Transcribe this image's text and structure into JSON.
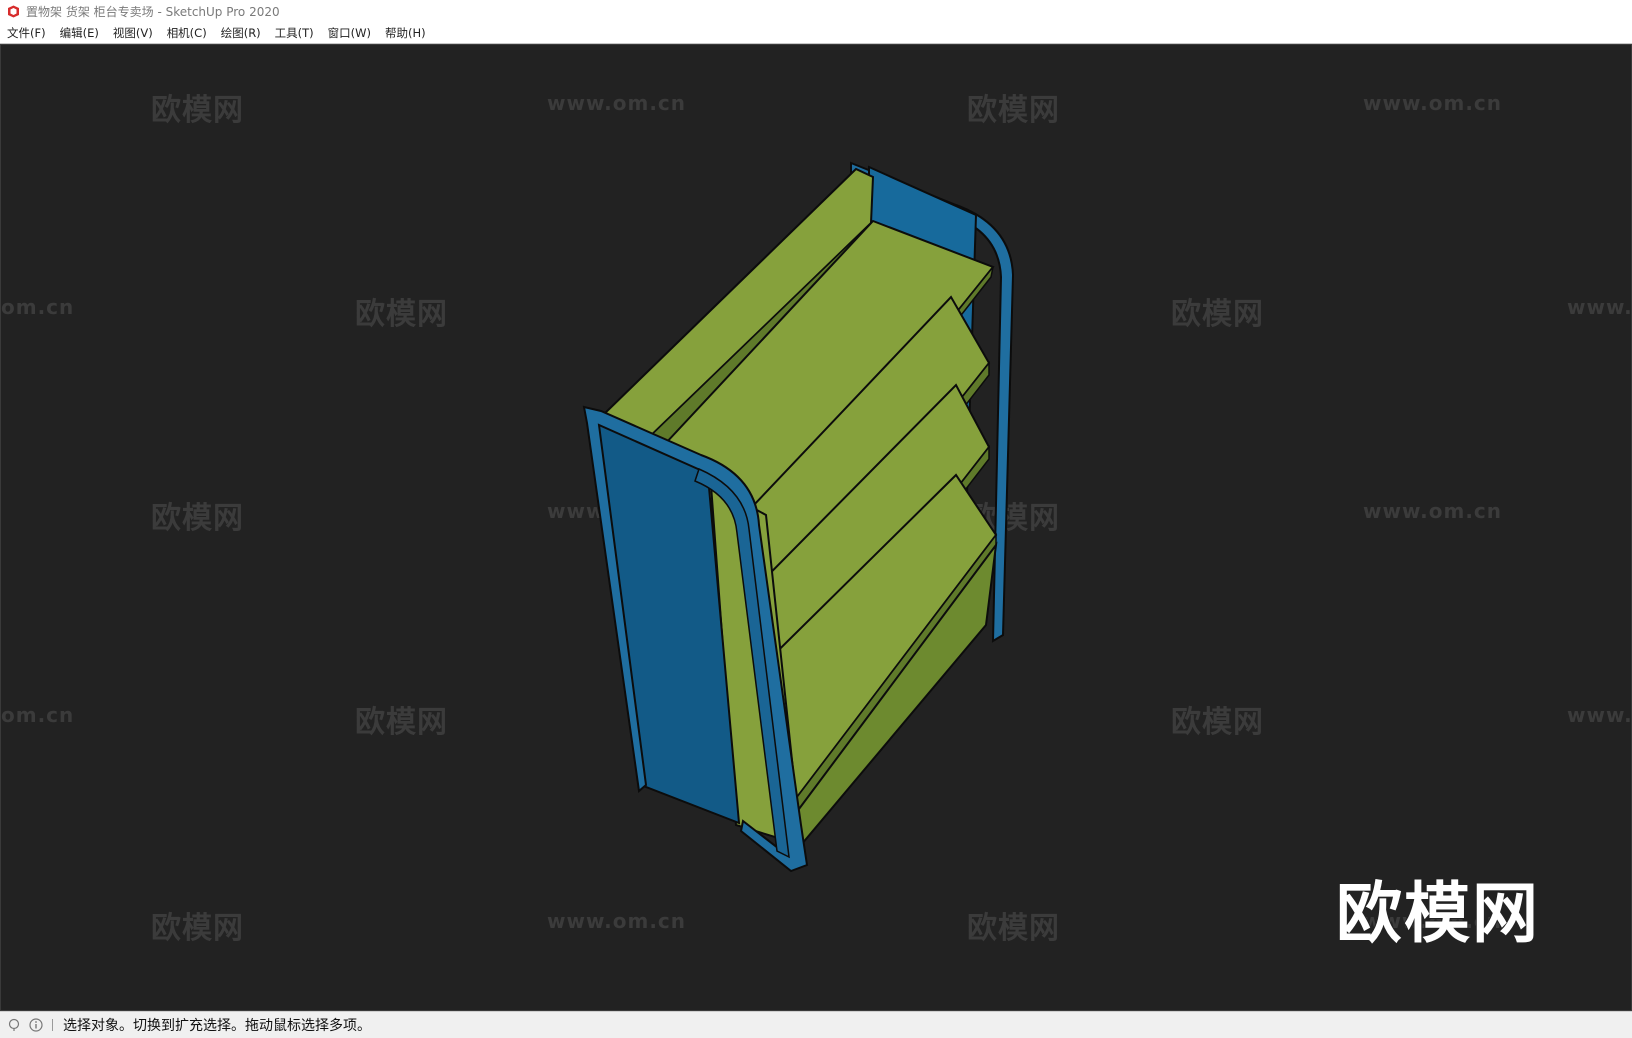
{
  "window": {
    "title": "置物架 货架 柜台专卖场 - SketchUp Pro 2020",
    "app_icon": "sketchup-icon"
  },
  "menu": {
    "items": [
      {
        "label": "文件(F)"
      },
      {
        "label": "编辑(E)"
      },
      {
        "label": "视图(V)"
      },
      {
        "label": "相机(C)"
      },
      {
        "label": "绘图(R)"
      },
      {
        "label": "工具(T)"
      },
      {
        "label": "窗口(W)"
      },
      {
        "label": "帮助(H)"
      }
    ]
  },
  "watermark": {
    "cn": "欧模网",
    "url": "www.om.cn",
    "url_partial_left": "om.cn",
    "url_partial_right": "www.",
    "big": "欧模网"
  },
  "status": {
    "message": "选择对象。切换到扩充选择。拖动鼠标选择多项。",
    "icons": [
      "geo-location-icon",
      "info-icon"
    ]
  },
  "colors": {
    "frame_blue": "#1f6ea0",
    "shelf_green": "#86a13c",
    "viewport_bg": "#222222"
  }
}
